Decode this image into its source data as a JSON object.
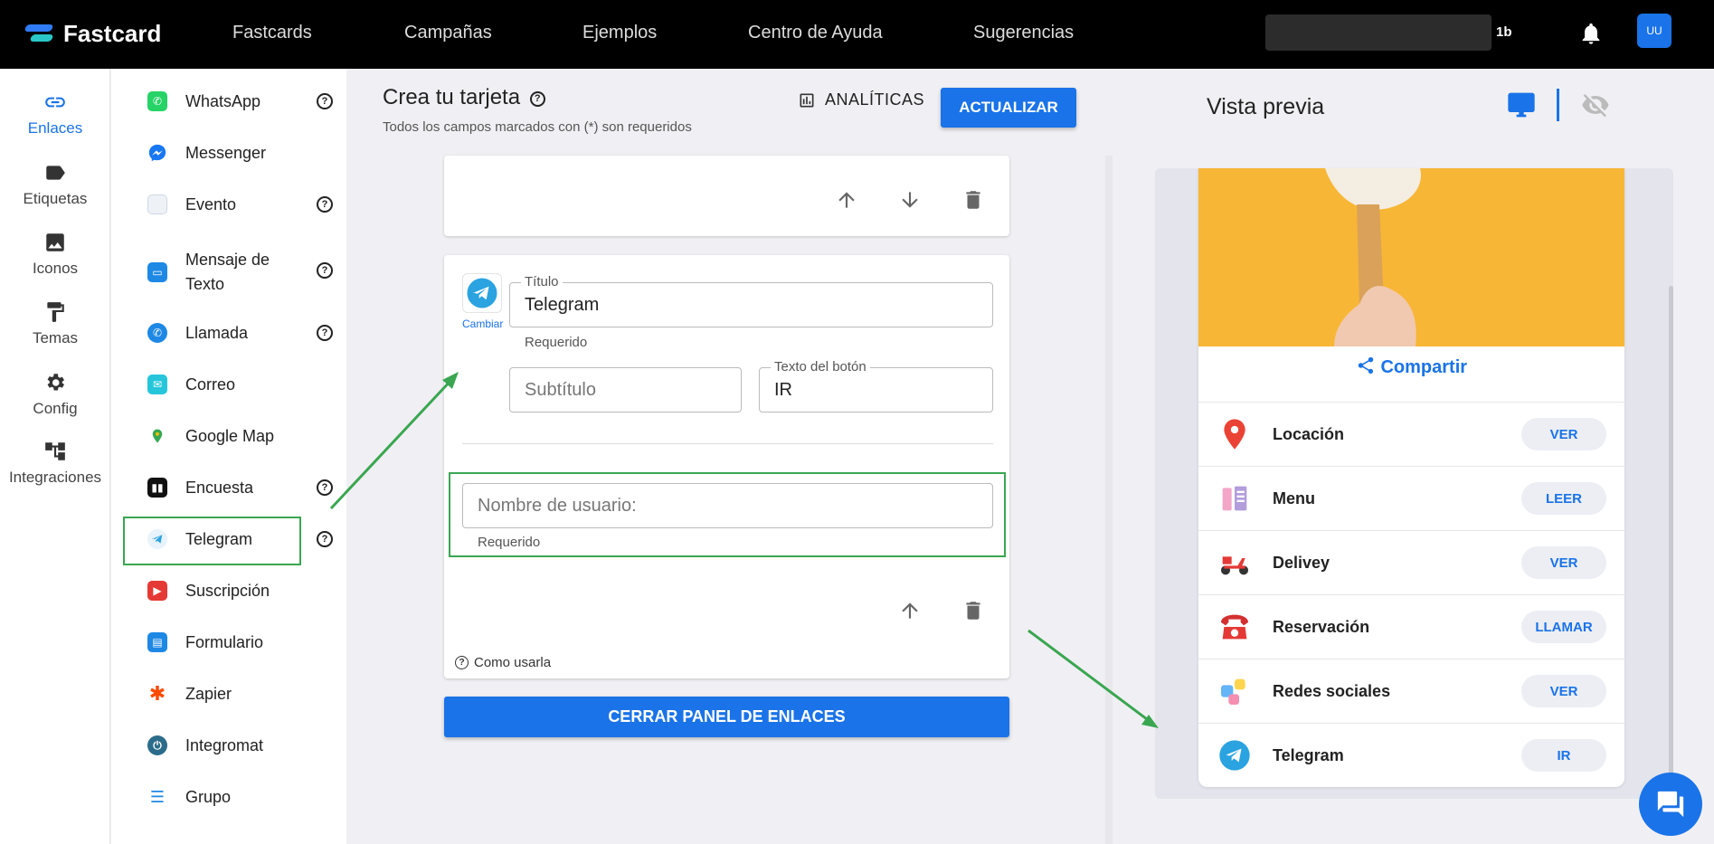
{
  "header": {
    "logo": "Fastcard",
    "nav": [
      "Fastcards",
      "Campañas",
      "Ejemplos",
      "Centro de Ayuda",
      "Sugerencias"
    ],
    "search_tail": "1b",
    "avatar": "UU"
  },
  "rail": [
    {
      "label": "Enlaces",
      "icon": "link-icon",
      "active": true
    },
    {
      "label": "Etiquetas",
      "icon": "label-icon"
    },
    {
      "label": "Iconos",
      "icon": "image-icon"
    },
    {
      "label": "Temas",
      "icon": "paint-roller-icon"
    },
    {
      "label": "Config",
      "icon": "gear-icon"
    },
    {
      "label": "Integraciones",
      "icon": "hierarchy-icon"
    }
  ],
  "link_types": [
    {
      "label": "WhatsApp",
      "help": true,
      "color": "#25d366"
    },
    {
      "label": "Messenger",
      "help": false,
      "color": "#1877f2"
    },
    {
      "label": "Evento",
      "help": true,
      "color": "#cfd8e3"
    },
    {
      "label": "Mensaje de Texto",
      "help": true,
      "color": "#1e88e5"
    },
    {
      "label": "Llamada",
      "help": true,
      "color": "#1e88e5"
    },
    {
      "label": "Correo",
      "help": false,
      "color": "#26c6da"
    },
    {
      "label": "Google Map",
      "help": false,
      "color": "#34a853"
    },
    {
      "label": "Encuesta",
      "help": true,
      "color": "#111111"
    },
    {
      "label": "Telegram",
      "help": true,
      "color": "#2aa3e0"
    },
    {
      "label": "Suscripción",
      "help": false,
      "color": "#e53935"
    },
    {
      "label": "Formulario",
      "help": false,
      "color": "#1e88e5"
    },
    {
      "label": "Zapier",
      "help": false,
      "color": "#ff4a00"
    },
    {
      "label": "Integromat",
      "help": false,
      "color": "#2b6c8a"
    },
    {
      "label": "Grupo",
      "help": false,
      "color": "#1e88e5"
    }
  ],
  "editor": {
    "title": "Crea tu tarjeta",
    "subtitle": "Todos los campos marcados con (*) son requeridos",
    "analytics_label": "ANALÍTICAS",
    "update_label": "ACTUALIZAR",
    "change_label": "Cambiar",
    "title_field_label": "Título",
    "title_field_value": "Telegram",
    "required": "Requerido",
    "subtitle_placeholder": "Subtítulo",
    "button_text_label": "Texto del botón",
    "button_text_value": "IR",
    "username_placeholder": "Nombre de usuario:",
    "how_to_use": "Como usarla",
    "close_panel_label": "CERRAR PANEL DE ENLACES"
  },
  "preview": {
    "title": "Vista previa",
    "share_label": "Compartir",
    "items": [
      {
        "label": "Locación",
        "button": "VER",
        "icon": "location-pin-icon"
      },
      {
        "label": "Menu",
        "button": "LEER",
        "icon": "menu-icon"
      },
      {
        "label": "Delivey",
        "button": "VER",
        "icon": "scooter-icon"
      },
      {
        "label": "Reservación",
        "button": "LLAMAR",
        "icon": "phone-icon"
      },
      {
        "label": "Redes sociales",
        "button": "VER",
        "icon": "social-icon"
      },
      {
        "label": "Telegram",
        "button": "IR",
        "icon": "telegram-icon"
      }
    ]
  },
  "colors": {
    "accent": "#1a73e8",
    "annotation": "#3aa651"
  }
}
